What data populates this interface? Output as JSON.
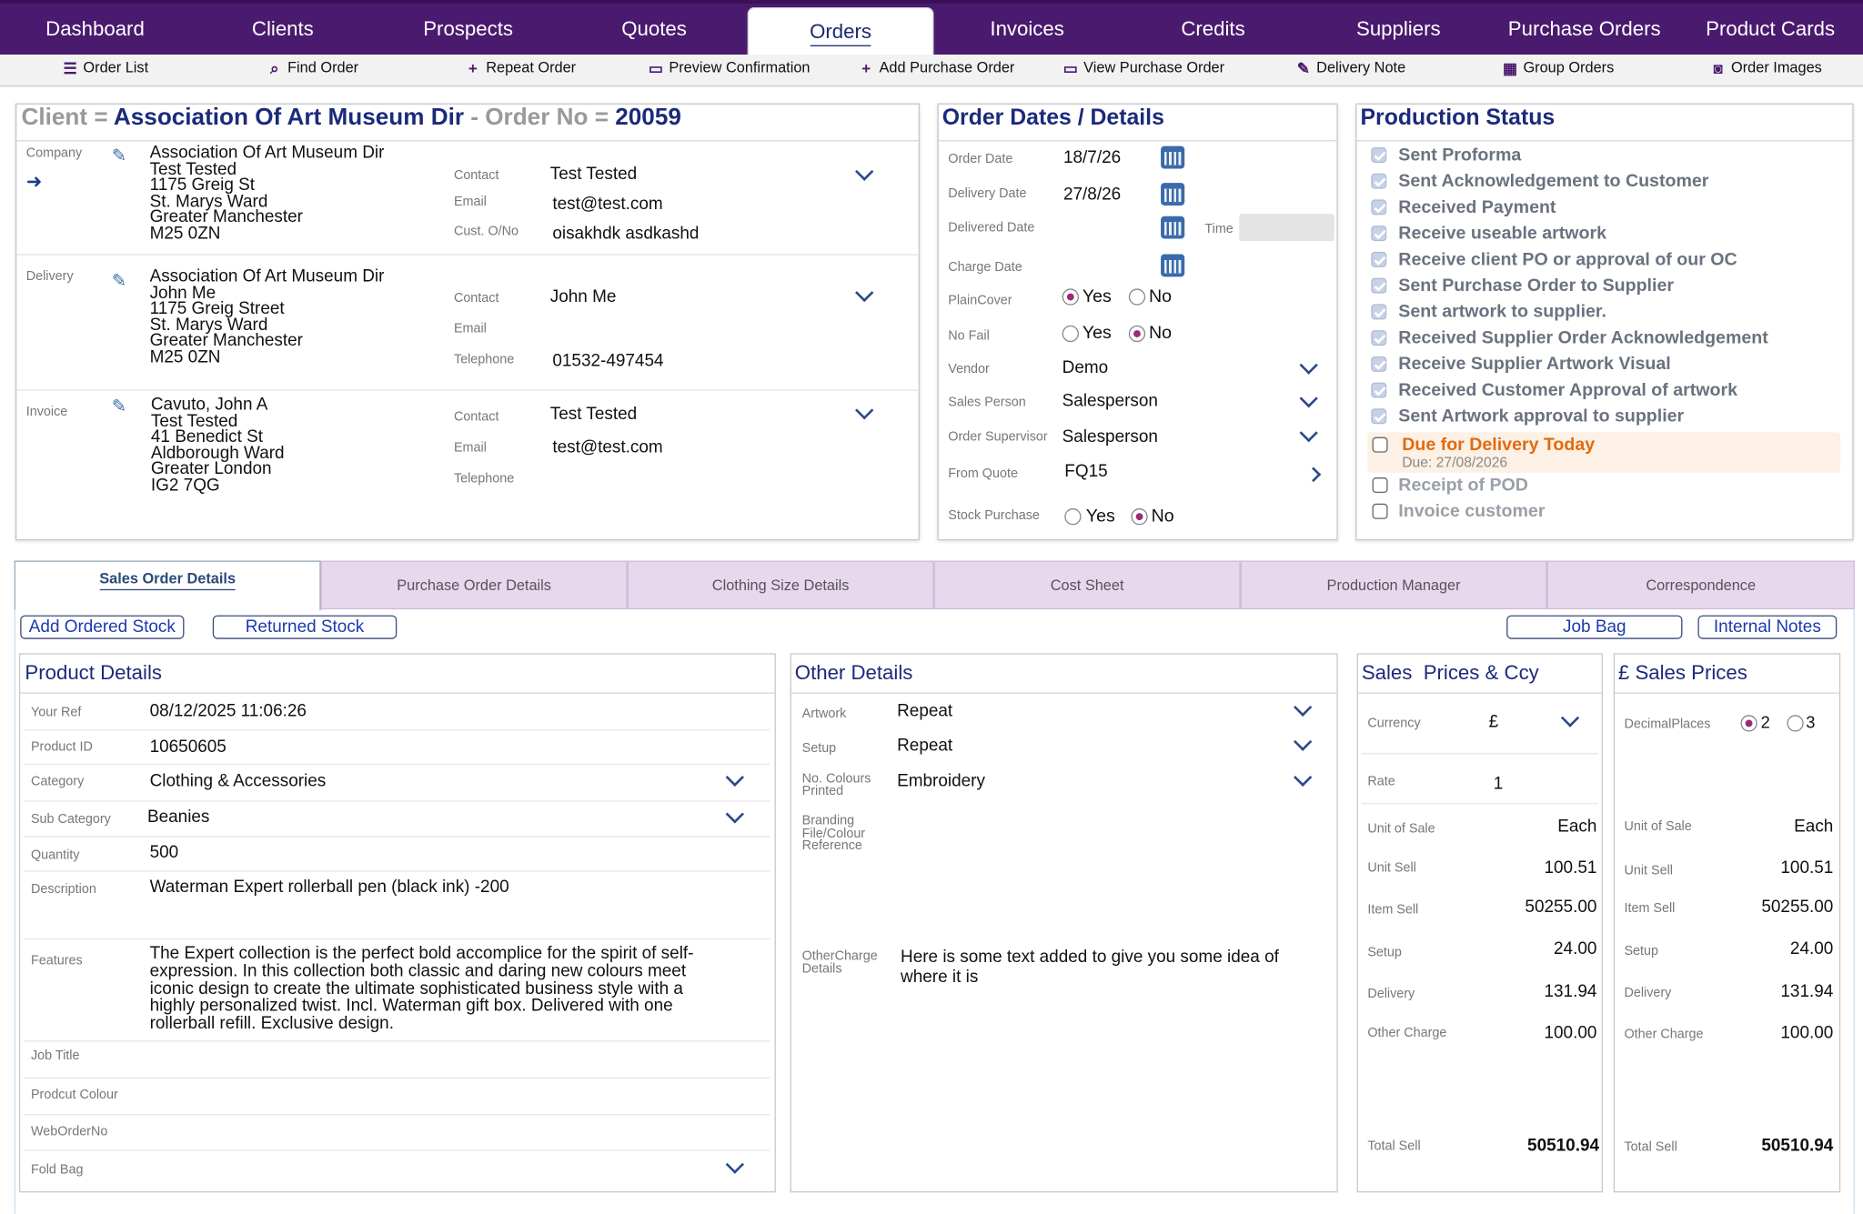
{
  "nav": {
    "tabs": [
      "Dashboard",
      "Clients",
      "Prospects",
      "Quotes",
      "Orders",
      "Invoices",
      "Credits",
      "Suppliers",
      "Purchase Orders",
      "Product Cards"
    ],
    "active": "Orders"
  },
  "toolbar": {
    "order_list": "Order List",
    "find_order": "Find Order",
    "repeat_order": "Repeat Order",
    "preview_confirmation": "Preview Confirmation",
    "add_purchase_order": "Add Purchase Order",
    "view_purchase_order": "View Purchase Order",
    "delivery_note": "Delivery Note",
    "group_orders": "Group Orders",
    "order_images": "Order Images"
  },
  "client_panel": {
    "client_prefix": "Client =",
    "client_name": "Association Of Art Museum Dir",
    "order_prefix": "- Order No =",
    "order_no": "20059",
    "company": {
      "label": "Company",
      "address": [
        "Association Of Art Museum Dir",
        "Test Tested",
        "1175 Greig St",
        "St. Marys Ward",
        "Greater Manchester",
        "M25 0ZN"
      ],
      "contact_label": "Contact",
      "contact": "Test Tested",
      "email_label": "Email",
      "email": "test@test.com",
      "custno_label": "Cust. O/No",
      "custno": "oisakhdk asdkashd"
    },
    "delivery": {
      "label": "Delivery",
      "address": [
        "Association Of Art Museum Dir",
        "John Me",
        "1175 Greig Street",
        "St. Marys Ward",
        "Greater Manchester",
        "M25 0ZN"
      ],
      "contact_label": "Contact",
      "contact": "John Me",
      "email_label": "Email",
      "email": "",
      "phone_label": "Telephone",
      "phone": "01532-497454"
    },
    "invoice": {
      "label": "Invoice",
      "address": [
        "Cavuto, John A",
        "Test Tested",
        "41 Benedict St",
        "Aldborough Ward",
        "Greater London",
        "IG2 7QG"
      ],
      "contact_label": "Contact",
      "contact": "Test Tested",
      "email_label": "Email",
      "email": "test@test.com",
      "phone_label": "Telephone",
      "phone": ""
    }
  },
  "order_dates": {
    "title": "Order Dates / Details",
    "order_date_label": "Order Date",
    "order_date": "18/7/26",
    "delivery_date_label": "Delivery Date",
    "delivery_date": "27/8/26",
    "delivered_date_label": "Delivered Date",
    "delivered_date": "",
    "time_label": "Time",
    "charge_date_label": "Charge Date",
    "plaincover_label": "PlainCover",
    "plaincover": "Yes",
    "nofail_label": "No Fail",
    "nofail": "No",
    "vendor_label": "Vendor",
    "vendor": "Demo",
    "sales_person_label": "Sales Person",
    "sales_person": "Salesperson",
    "supervisor_label": "Order Supervisor",
    "supervisor": "Salesperson",
    "from_quote_label": "From Quote",
    "from_quote": "FQ15",
    "stock_purchase_label": "Stock Purchase",
    "stock_purchase": "No",
    "yes": "Yes",
    "no": "No"
  },
  "production": {
    "title": "Production Status",
    "done": [
      "Sent Proforma",
      "Sent Acknowledgement to Customer",
      "Received Payment",
      "Receive useable artwork",
      "Receive client PO or approval of our OC",
      "Sent Purchase Order to Supplier",
      "Sent artwork to supplier.",
      "Received Supplier Order Acknowledgement",
      "Receive Supplier Artwork Visual",
      "Received Customer Approval of artwork",
      "Sent Artwork approval to supplier"
    ],
    "due_label": "Due for Delivery Today",
    "due_date": "Due: 27/08/2026",
    "pending": [
      "Receipt of POD",
      "Invoice customer"
    ],
    "due_color": "#e06a10"
  },
  "tabs": [
    "Sales Order Details",
    "Purchase Order Details",
    "Clothing Size Details",
    "Cost Sheet",
    "Production Manager",
    "Correspondence"
  ],
  "buttons": {
    "add_ordered_stock": "Add Ordered Stock",
    "returned_stock": "Returned Stock",
    "job_bag": "Job Bag",
    "internal_notes": "Internal Notes"
  },
  "product": {
    "title": "Product Details",
    "your_ref_label": "Your Ref",
    "your_ref": "08/12/2025 11:06:26",
    "product_id_label": "Product ID",
    "product_id": "10650605",
    "category_label": "Category",
    "category": "Clothing & Accessories",
    "sub_category_label": "Sub Category",
    "sub_category": "Beanies",
    "quantity_label": "Quantity",
    "quantity": "500",
    "description_label": "Description",
    "description": "Waterman Expert rollerball pen (black ink) -200",
    "features_label": "Features",
    "features": "The Expert collection is the perfect bold accomplice for the spirit of self-expression. In this collection both classic and daring new colours meet iconic design to create the ultimate sophisticated business style with a highly personalized twist. Incl. Waterman gift box. Delivered with one rollerball refill. Exclusive design.",
    "job_title_label": "Job Title",
    "colour_label": "Prodcut Colour",
    "web_order_label": "WebOrderNo",
    "fold_bag_label": "Fold Bag"
  },
  "other": {
    "title": "Other Details",
    "artwork_label": "Artwork",
    "artwork": "Repeat",
    "setup_label": "Setup",
    "setup": "Repeat",
    "colours_label_1": "No. Colours",
    "colours_label_2": "Printed",
    "colours": "Embroidery",
    "branding_label_1": "Branding",
    "branding_label_2": "File/Colour",
    "branding_label_3": "Reference",
    "othercharge_label_1": "OtherCharge",
    "othercharge_label_2": "Details",
    "othercharge": "Here is some text added to give you some idea of where it is"
  },
  "sales_ccy": {
    "title": "Sales  Prices & Ccy",
    "currency_label": "Currency",
    "currency": "£",
    "rate_label": "Rate",
    "rate": "1",
    "unit_label": "Unit of Sale",
    "unit": "Each",
    "unit_sell_label": "Unit Sell",
    "unit_sell": "100.51",
    "item_sell_label": "Item Sell",
    "item_sell": "50255.00",
    "setup_label": "Setup",
    "setup": "24.00",
    "delivery_label": "Delivery",
    "delivery": "131.94",
    "other_label": "Other Charge",
    "other": "100.00",
    "total_label": "Total Sell",
    "total": "50510.94"
  },
  "sales_gbp": {
    "title": "£ Sales Prices",
    "decimal_label": "DecimalPlaces",
    "dec2": "2",
    "dec3": "3",
    "unit_label": "Unit of Sale",
    "unit": "Each",
    "unit_sell_label": "Unit Sell",
    "unit_sell": "100.51",
    "item_sell_label": "Item Sell",
    "item_sell": "50255.00",
    "setup_label": "Setup",
    "setup": "24.00",
    "delivery_label": "Delivery",
    "delivery": "131.94",
    "other_label": "Other Charge",
    "other": "100.00",
    "total_label": "Total Sell",
    "total": "50510.94"
  }
}
